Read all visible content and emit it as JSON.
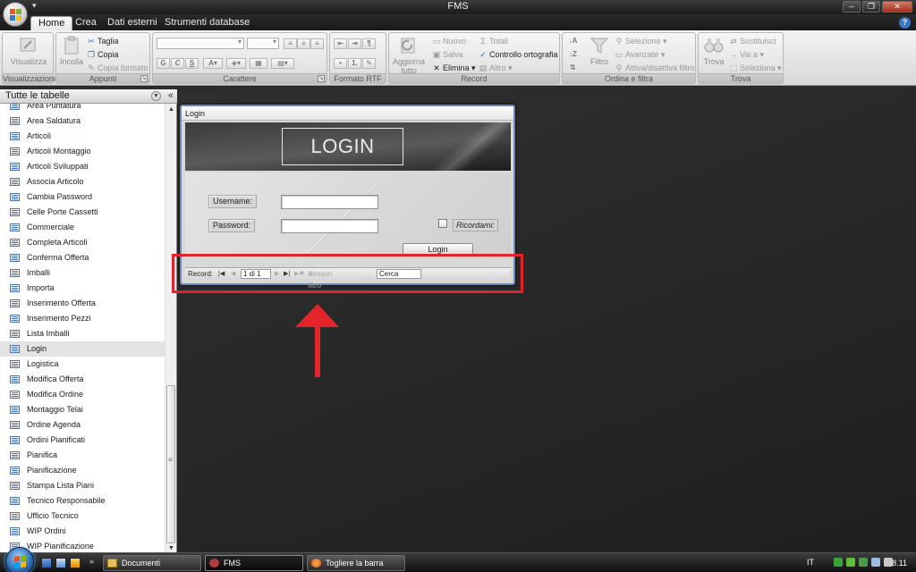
{
  "window": {
    "title": "FMS",
    "quick_access": "▾"
  },
  "tabs": [
    {
      "label": "Home",
      "active": true
    },
    {
      "label": "Crea",
      "active": false
    },
    {
      "label": "Dati esterni",
      "active": false
    },
    {
      "label": "Strumenti database",
      "active": false
    }
  ],
  "ribbon": {
    "visualizzazioni": {
      "big": "Visualizza",
      "label": "Visualizzazioni"
    },
    "appunti": {
      "big": "Incolla",
      "taglia": "Taglia",
      "copia": "Copia",
      "copia_formato": "Copia formato",
      "label": "Appunti"
    },
    "carattere": {
      "bold": "G",
      "italic": "C",
      "underline": "S",
      "label": "Carattere"
    },
    "formato_rtf": {
      "label": "Formato RTF"
    },
    "record": {
      "big": "Aggiorna tutto",
      "nuovo": "Nuovo",
      "salva": "Salva",
      "elimina": "Elimina",
      "totali": "Totali",
      "controllo": "Controllo ortografia",
      "altro": "Altro",
      "label": "Record"
    },
    "ordina": {
      "big": "Filtro",
      "selezione": "Selezione",
      "avanzate": "Avanzate",
      "attiva": "Attiva/disattiva filtro",
      "label": "Ordina e filtra"
    },
    "trova": {
      "big": "Trova",
      "sostituisci": "Sostituisci",
      "vai": "Vai a",
      "seleziona": "Seleziona",
      "label": "Trova"
    }
  },
  "navpane": {
    "header": "Tutte le tabelle",
    "items": [
      "Area Puntatura",
      "Area Saldatura",
      "Articoli",
      "Articoli Montaggio",
      "Articoli Sviluppati",
      "Associa Articolo",
      "Cambia Password",
      "Celle Porte Cassetti",
      "Commerciale",
      "Completa Articoli",
      "Conferma Offerta",
      "Imballi",
      "Importa",
      "Inserimento Offerta",
      "Inserimento Pezzi",
      "Lista Imballi",
      "Login",
      "Logistica",
      "Modifica Offerta",
      "Modifica Ordine",
      "Montaggio Telai",
      "Ordine Agenda",
      "Ordini Pianificati",
      "Pianifica",
      "Pianificazione",
      "Stampa Lista Piani",
      "Tecnico Responsabile",
      "Ufficio Tecnico",
      "WIP Ordini",
      "WIP Pianificazione"
    ],
    "selected": "Login"
  },
  "login_form": {
    "caption": "Login",
    "banner": "LOGIN",
    "username_label": "Username:",
    "password_label": "Password:",
    "remember_label": "Ricordami:",
    "button": "Login"
  },
  "record_bar": {
    "label": "Record:",
    "current": "1 di 1",
    "no_filter": "Nessun filtro",
    "search": "Cerca"
  },
  "annotation": {
    "color": "#e3242b"
  },
  "taskbar": {
    "tasks": [
      {
        "label": "Documenti",
        "active": false
      },
      {
        "label": "FMS",
        "active": true
      },
      {
        "label": "Togliere la barra Rec...",
        "active": false
      }
    ],
    "language": "IT",
    "clock": "8.11"
  }
}
